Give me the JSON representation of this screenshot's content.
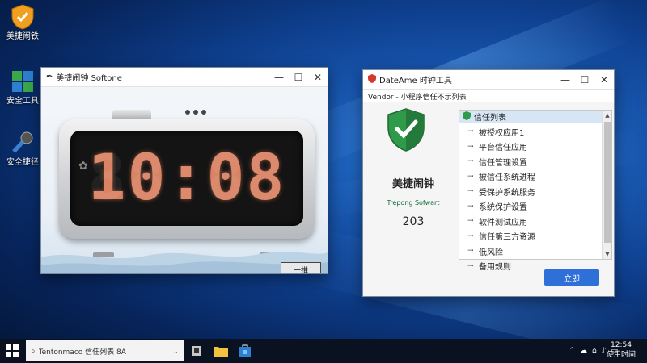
{
  "desktop": {
    "icons": [
      {
        "name": "shield-app",
        "label": "美捷闹铁"
      },
      {
        "name": "grid-app",
        "label": "安全工具"
      },
      {
        "name": "mic-app",
        "label": "安全捷径"
      }
    ]
  },
  "clock_window": {
    "title": "美捷闹钟 Softone",
    "time": "10:08",
    "ghost": "88:88",
    "dismiss_label": "一推"
  },
  "trust_window": {
    "title": "DateAme 时钟工具",
    "subtitle": "Vendor - 小程序信任不示列表",
    "app_name": "美捷闹钟",
    "vendor": "Trepong Sofwart",
    "count": "203",
    "list_title": "信任列表",
    "items": [
      "被授权应用1",
      "平台信任应用",
      "信任管理设置",
      "被信任系统进程",
      "受保护系统服务",
      "系统保护设置",
      "软件测试应用",
      "信任第三方资源",
      "低风险",
      "备用规则"
    ],
    "confirm_label": "立即"
  },
  "taskbar": {
    "search_text": "Tentonmaco 信任列表 8A",
    "tray_time": "12:54",
    "tray_date": "使用时间"
  },
  "colors": {
    "accent": "#2e6fd8",
    "digit": "#d98365",
    "shield_green": "#2e9a4a"
  }
}
